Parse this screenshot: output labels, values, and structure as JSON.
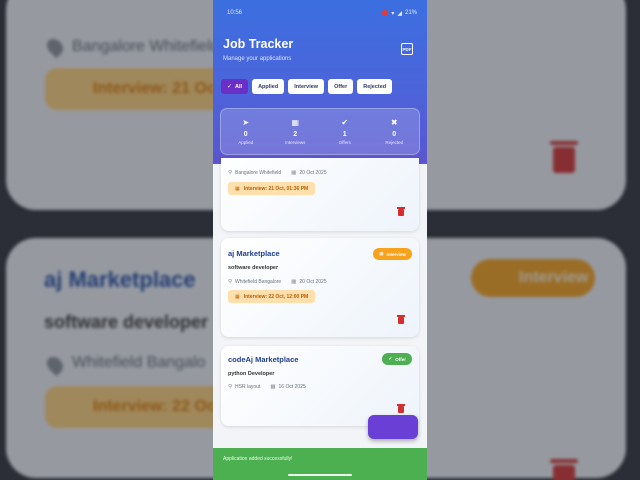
{
  "status_bar": {
    "time": "10:56",
    "battery": "21%"
  },
  "header": {
    "title": "Job Tracker",
    "subtitle": "Manage your applications",
    "pdf_icon": "PDF"
  },
  "filters": [
    {
      "label": "All",
      "active": true
    },
    {
      "label": "Applied",
      "active": false
    },
    {
      "label": "Interview",
      "active": false
    },
    {
      "label": "Offer",
      "active": false
    },
    {
      "label": "Rejected",
      "active": false
    }
  ],
  "stats": [
    {
      "icon": "send-icon",
      "glyph": "➤",
      "count": "0",
      "label": "Applied"
    },
    {
      "icon": "calendar-icon",
      "glyph": "▦",
      "count": "2",
      "label": "Interviews"
    },
    {
      "icon": "check-circle-icon",
      "glyph": "✔",
      "count": "1",
      "label": "Offers"
    },
    {
      "icon": "cancel-circle-icon",
      "glyph": "✖",
      "count": "0",
      "label": "Rejected"
    }
  ],
  "cards": [
    {
      "company": "",
      "role": "",
      "location": "Bangalore Whitefield",
      "date": "20 Oct 2025",
      "interview": "Interview: 21 Oct, 01:36 PM",
      "badge": ""
    },
    {
      "company": "aj Marketplace",
      "role": "software developer",
      "location": "Whitefield Bangalore",
      "date": "20 Oct 2025",
      "interview": "Interview: 22 Oct, 12:00 PM",
      "badge": "Interview"
    },
    {
      "company": "codeAj Marketplace",
      "role": "python Developer",
      "location": "HSR layout",
      "date": "16 Oct 2025",
      "interview": "",
      "badge": "Offer"
    }
  ],
  "snackbar": {
    "message": "Application added successfully!"
  },
  "background": {
    "location1": "Bangalore Whitefield",
    "interview1": "Interview: 21 Oct",
    "company2": "aj Marketplace",
    "role2": "software developer",
    "location2": "Whitefield Bangalo",
    "interview2": "Interview: 22 Oc",
    "badge2": "Interview"
  },
  "colors": {
    "accent": "#6a2fc7",
    "header_top": "#3b6fe0",
    "offer": "#4caf50",
    "interview": "#f6a21c",
    "delete": "#d32f2f"
  }
}
